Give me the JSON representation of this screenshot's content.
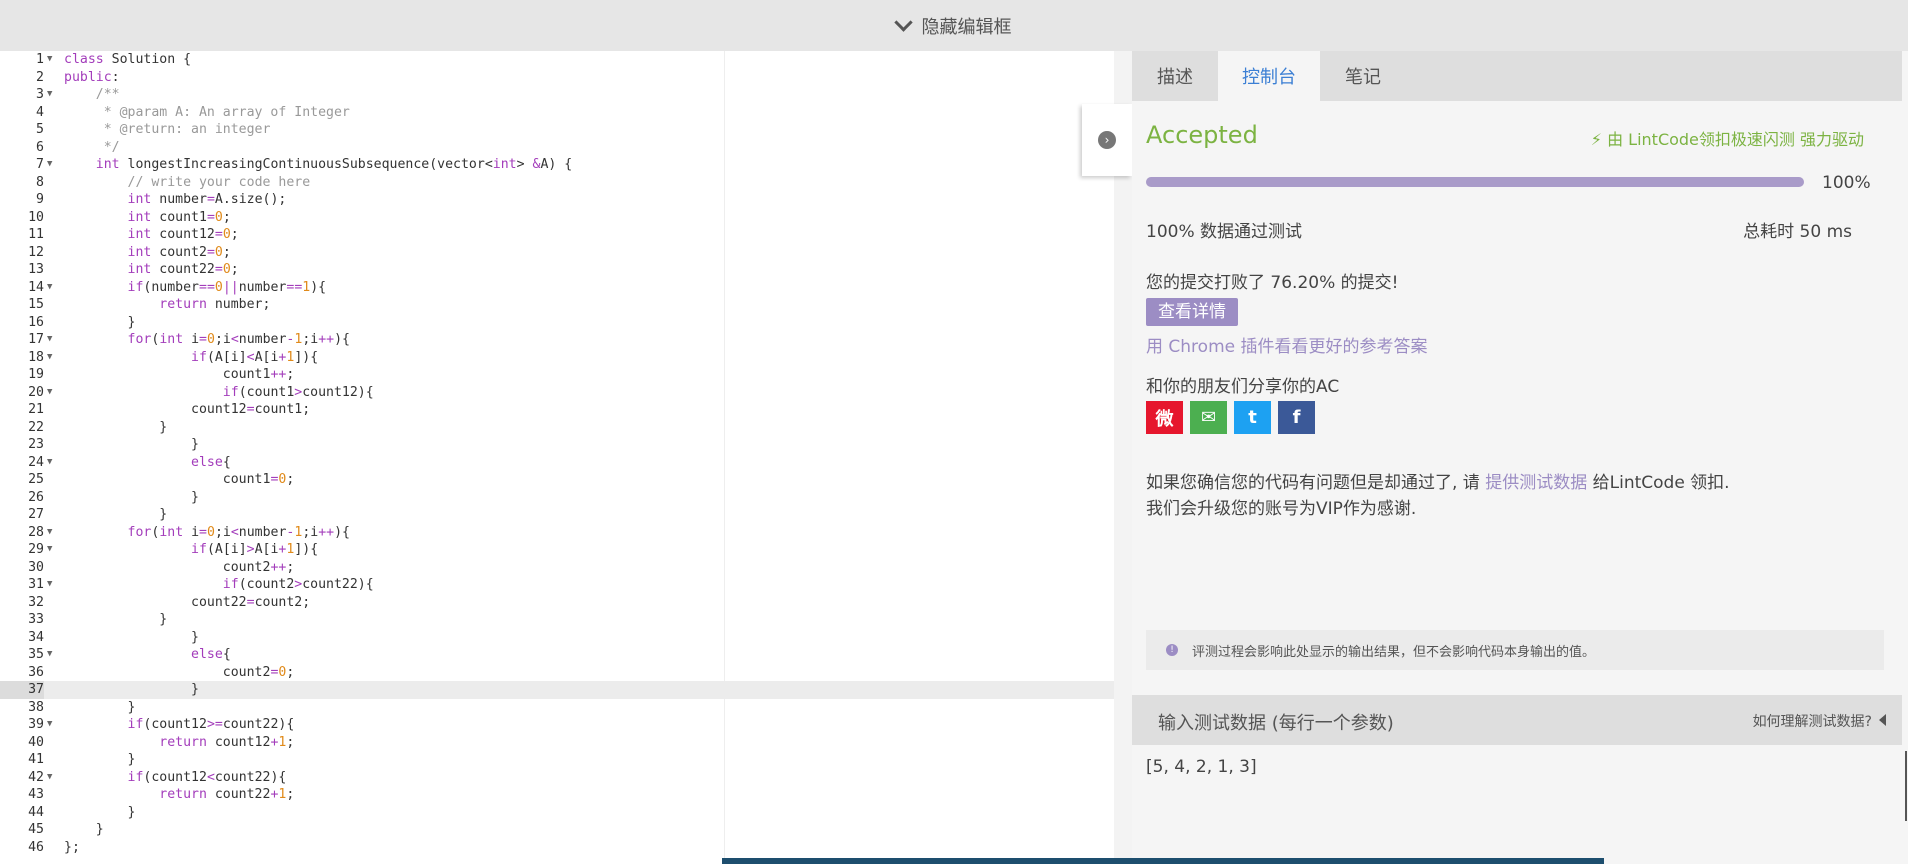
{
  "topbar": {
    "label": "隐藏编辑框"
  },
  "editor": {
    "active_line": 37,
    "lines": [
      {
        "n": "1",
        "fold": true,
        "html": "<span class=\"k\">class</span> Solution {"
      },
      {
        "n": "2",
        "fold": false,
        "html": "<span class=\"k\">public</span>:"
      },
      {
        "n": "3",
        "fold": true,
        "html": "    <span class=\"c\">/**</span>"
      },
      {
        "n": "4",
        "fold": false,
        "html": "     <span class=\"c\">* @param A: An array of Integer</span>"
      },
      {
        "n": "5",
        "fold": false,
        "html": "     <span class=\"c\">* @return: an integer</span>"
      },
      {
        "n": "6",
        "fold": false,
        "html": "     <span class=\"c\">*/</span>"
      },
      {
        "n": "7",
        "fold": true,
        "html": "    <span class=\"k\">int</span> longestIncreasingContinuousSubsequence(vector&lt;<span class=\"k\">int</span>&gt; <span class=\"o\">&amp;</span>A) {"
      },
      {
        "n": "8",
        "fold": false,
        "html": "        <span class=\"c\">// write your code here</span>"
      },
      {
        "n": "9",
        "fold": false,
        "html": "        <span class=\"k\">int</span> number<span class=\"o\">=</span>A.size();"
      },
      {
        "n": "10",
        "fold": false,
        "html": "        <span class=\"k\">int</span> count1<span class=\"o\">=</span><span class=\"n\">0</span>;"
      },
      {
        "n": "11",
        "fold": false,
        "html": "        <span class=\"k\">int</span> count12<span class=\"o\">=</span><span class=\"n\">0</span>;"
      },
      {
        "n": "12",
        "fold": false,
        "html": "        <span class=\"k\">int</span> count2<span class=\"o\">=</span><span class=\"n\">0</span>;"
      },
      {
        "n": "13",
        "fold": false,
        "html": "        <span class=\"k\">int</span> count22<span class=\"o\">=</span><span class=\"n\">0</span>;"
      },
      {
        "n": "14",
        "fold": true,
        "html": "        <span class=\"k\">if</span>(number<span class=\"o\">==</span><span class=\"n\">0</span><span class=\"o\">||</span>number<span class=\"o\">==</span><span class=\"n\">1</span>){"
      },
      {
        "n": "15",
        "fold": false,
        "html": "            <span class=\"k\">return</span> number;"
      },
      {
        "n": "16",
        "fold": false,
        "html": "        }"
      },
      {
        "n": "17",
        "fold": true,
        "html": "        <span class=\"k\">for</span>(<span class=\"k\">int</span> i<span class=\"o\">=</span><span class=\"n\">0</span>;i<span class=\"o\">&lt;</span>number<span class=\"o\">-</span><span class=\"n\">1</span>;i<span class=\"o\">++</span>){"
      },
      {
        "n": "18",
        "fold": true,
        "html": "                <span class=\"k\">if</span>(A[i]<span class=\"o\">&lt;</span>A[i<span class=\"o\">+</span><span class=\"n\">1</span>]){"
      },
      {
        "n": "19",
        "fold": false,
        "html": "                    count1<span class=\"o\">++</span>;"
      },
      {
        "n": "20",
        "fold": true,
        "html": "                    <span class=\"k\">if</span>(count1<span class=\"o\">&gt;</span>count12){"
      },
      {
        "n": "21",
        "fold": false,
        "html": "                count12<span class=\"o\">=</span>count1;"
      },
      {
        "n": "22",
        "fold": false,
        "html": "            }"
      },
      {
        "n": "23",
        "fold": false,
        "html": "                }"
      },
      {
        "n": "24",
        "fold": true,
        "html": "                <span class=\"k\">else</span>{"
      },
      {
        "n": "25",
        "fold": false,
        "html": "                    count1<span class=\"o\">=</span><span class=\"n\">0</span>;"
      },
      {
        "n": "26",
        "fold": false,
        "html": "                }"
      },
      {
        "n": "27",
        "fold": false,
        "html": "            }"
      },
      {
        "n": "28",
        "fold": true,
        "html": "        <span class=\"k\">for</span>(<span class=\"k\">int</span> i<span class=\"o\">=</span><span class=\"n\">0</span>;i<span class=\"o\">&lt;</span>number<span class=\"o\">-</span><span class=\"n\">1</span>;i<span class=\"o\">++</span>){"
      },
      {
        "n": "29",
        "fold": true,
        "html": "                <span class=\"k\">if</span>(A[i]<span class=\"o\">&gt;</span>A[i<span class=\"o\">+</span><span class=\"n\">1</span>]){"
      },
      {
        "n": "30",
        "fold": false,
        "html": "                    count2<span class=\"o\">++</span>;"
      },
      {
        "n": "31",
        "fold": true,
        "html": "                    <span class=\"k\">if</span>(count2<span class=\"o\">&gt;</span>count22){"
      },
      {
        "n": "32",
        "fold": false,
        "html": "                count22<span class=\"o\">=</span>count2;"
      },
      {
        "n": "33",
        "fold": false,
        "html": "            }"
      },
      {
        "n": "34",
        "fold": false,
        "html": "                }"
      },
      {
        "n": "35",
        "fold": true,
        "html": "                <span class=\"k\">else</span>{"
      },
      {
        "n": "36",
        "fold": false,
        "html": "                    count2<span class=\"o\">=</span><span class=\"n\">0</span>;"
      },
      {
        "n": "37",
        "fold": false,
        "html": "                }"
      },
      {
        "n": "38",
        "fold": false,
        "html": "        }"
      },
      {
        "n": "39",
        "fold": true,
        "html": "        <span class=\"k\">if</span>(count12<span class=\"o\">&gt;=</span>count22){"
      },
      {
        "n": "40",
        "fold": false,
        "html": "            <span class=\"k\">return</span> count12<span class=\"o\">+</span><span class=\"n\">1</span>;"
      },
      {
        "n": "41",
        "fold": false,
        "html": "        }"
      },
      {
        "n": "42",
        "fold": true,
        "html": "        <span class=\"k\">if</span>(count12<span class=\"o\">&lt;</span>count22){"
      },
      {
        "n": "43",
        "fold": false,
        "html": "            <span class=\"k\">return</span> count22<span class=\"o\">+</span><span class=\"n\">1</span>;"
      },
      {
        "n": "44",
        "fold": false,
        "html": "        }"
      },
      {
        "n": "45",
        "fold": false,
        "html": "    }"
      },
      {
        "n": "46",
        "fold": false,
        "html": "};"
      }
    ]
  },
  "panel": {
    "tabs": [
      {
        "label": "描述",
        "active": false
      },
      {
        "label": "控制台",
        "active": true
      },
      {
        "label": "笔记",
        "active": false
      }
    ],
    "status": "Accepted",
    "powered_by": "由 LintCode领扣极速闪测 强力驱动",
    "progress_fraction": 1.0,
    "progress_label": "100%",
    "tests_passed": "100% 数据通过测试",
    "time_total": "总耗时 50 ms",
    "beat": "您的提交打败了 76.20% 的提交!",
    "detail_button": "查看详情",
    "chrome_link": "用 Chrome 插件看看更好的参考答案",
    "share_label": "和你的朋友们分享你的AC",
    "share_icons": [
      {
        "name": "weibo-icon",
        "glyph": "微",
        "color": "#e6162d"
      },
      {
        "name": "wechat-icon",
        "glyph": "✉",
        "color": "#4caf50"
      },
      {
        "name": "twitter-icon",
        "glyph": "t",
        "color": "#1da1f2"
      },
      {
        "name": "facebook-icon",
        "glyph": "f",
        "color": "#3b5998"
      }
    ],
    "note_prefix": "如果您确信您的代码有问题但是却通过了, 请 ",
    "note_link": "提供测试数据",
    "note_suffix": " 给LintCode 领扣.",
    "note_line2": "我们会升级您的账号为VIP作为感谢.",
    "info_text": "评测过程会影响此处显示的输出结果，但不会影响代码本身输出的值。",
    "input_label": "输入测试数据 (每行一个参数)",
    "input_help": "如何理解测试数据?",
    "input_value": "[5, 4, 2, 1, 3]"
  },
  "colors": {
    "accepted": "#7cb342",
    "accent": "#9c8dc4",
    "tab_active": "#3b7fd4"
  }
}
